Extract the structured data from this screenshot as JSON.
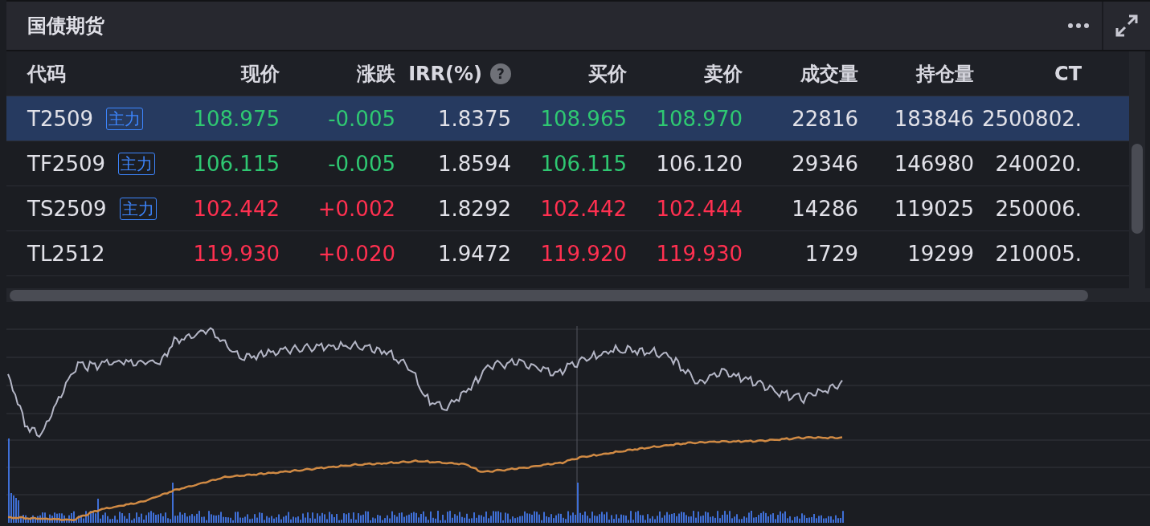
{
  "panel": {
    "title": "国债期货"
  },
  "table": {
    "columns": [
      {
        "label": "代码"
      },
      {
        "label": "现价"
      },
      {
        "label": "涨跌"
      },
      {
        "label": "IRR(%)",
        "help": "?"
      },
      {
        "label": "买价"
      },
      {
        "label": "卖价"
      },
      {
        "label": "成交量"
      },
      {
        "label": "持仓量"
      },
      {
        "label": "CT"
      }
    ],
    "rows": [
      {
        "selected": true,
        "cells": [
          {
            "text": "T2509",
            "tag": "主力",
            "color": "#e1e1e8"
          },
          {
            "text": "108.975",
            "color": "#2fc872"
          },
          {
            "text": "-0.005",
            "color": "#2fc872"
          },
          {
            "text": "1.8375",
            "color": "#e1e1e8"
          },
          {
            "text": "108.965",
            "color": "#2fc872"
          },
          {
            "text": "108.970",
            "color": "#2fc872"
          },
          {
            "text": "22816",
            "color": "#e1e1e8"
          },
          {
            "text": "183846",
            "color": "#e1e1e8"
          },
          {
            "text": "2500802.",
            "color": "#e1e1e8"
          }
        ]
      },
      {
        "selected": false,
        "cells": [
          {
            "text": "TF2509",
            "tag": "主力",
            "color": "#e1e1e8"
          },
          {
            "text": "106.115",
            "color": "#2fc872"
          },
          {
            "text": "-0.005",
            "color": "#2fc872"
          },
          {
            "text": "1.8594",
            "color": "#e1e1e8"
          },
          {
            "text": "106.115",
            "color": "#2fc872"
          },
          {
            "text": "106.120",
            "color": "#e1e1e8"
          },
          {
            "text": "29346",
            "color": "#e1e1e8"
          },
          {
            "text": "146980",
            "color": "#e1e1e8"
          },
          {
            "text": "240020.",
            "color": "#e1e1e8"
          }
        ]
      },
      {
        "selected": false,
        "cells": [
          {
            "text": "TS2509",
            "tag": "主力",
            "color": "#e1e1e8"
          },
          {
            "text": "102.442",
            "color": "#ff3050"
          },
          {
            "text": "+0.002",
            "color": "#ff3050"
          },
          {
            "text": "1.8292",
            "color": "#e1e1e8"
          },
          {
            "text": "102.442",
            "color": "#ff3050"
          },
          {
            "text": "102.444",
            "color": "#ff3050"
          },
          {
            "text": "14286",
            "color": "#e1e1e8"
          },
          {
            "text": "119025",
            "color": "#e1e1e8"
          },
          {
            "text": "250006.",
            "color": "#e1e1e8"
          }
        ]
      },
      {
        "selected": false,
        "cells": [
          {
            "text": "TL2512",
            "color": "#e1e1e8"
          },
          {
            "text": "119.930",
            "color": "#ff3050"
          },
          {
            "text": "+0.020",
            "color": "#ff3050"
          },
          {
            "text": "1.9472",
            "color": "#e1e1e8"
          },
          {
            "text": "119.920",
            "color": "#ff3050"
          },
          {
            "text": "119.930",
            "color": "#ff3050"
          },
          {
            "text": "1729",
            "color": "#e1e1e8"
          },
          {
            "text": "19299",
            "color": "#e1e1e8"
          },
          {
            "text": "210005.",
            "color": "#e1e1e8"
          }
        ]
      }
    ]
  }
}
